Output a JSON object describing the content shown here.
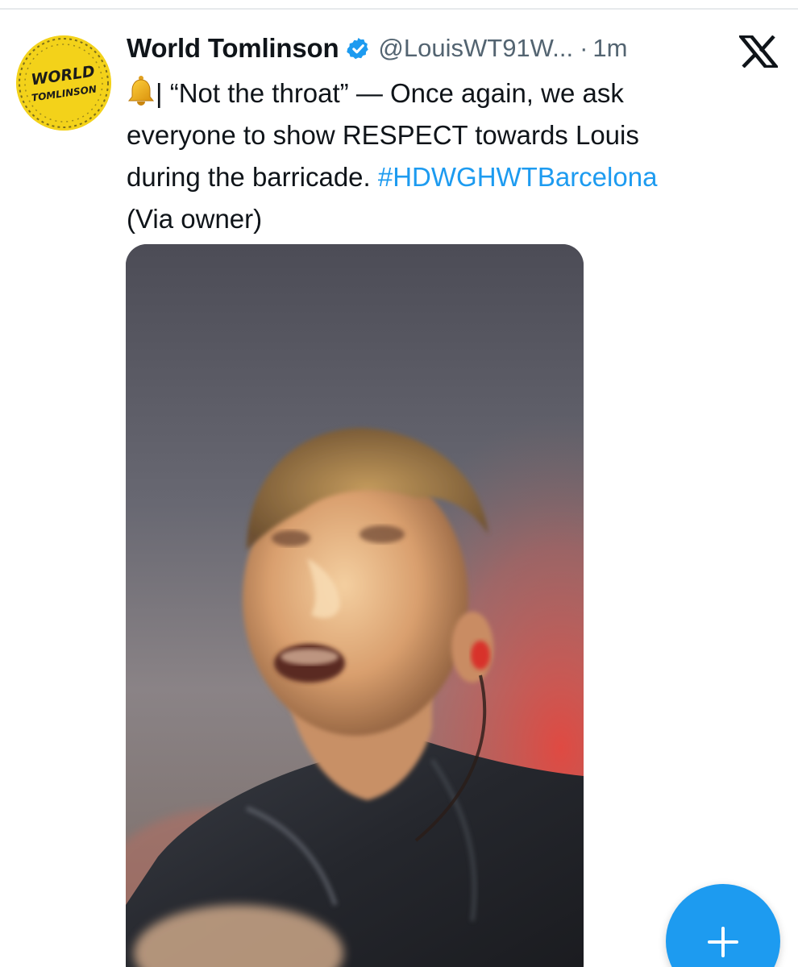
{
  "tweet": {
    "author": {
      "display_name": "World Tomlinson",
      "handle": "@LouisWT91W...",
      "verified": true,
      "avatar_text": [
        "WORLD",
        "TOMLINSON"
      ]
    },
    "separator": "·",
    "timestamp": "1m",
    "text": {
      "line1_rest": "| “Not the throat” — Once again, we ask",
      "line2": "everyone to show RESPECT towards Louis",
      "line3_text": "during the barricade. ",
      "hashtag": "#HDWGHWTBarcelona",
      "line4": "(Via owner)"
    },
    "icons": {
      "bell": "bell-emoji-icon",
      "verified": "verified-badge-icon",
      "platform": "x-logo-icon"
    },
    "media": {
      "type": "video-still"
    }
  },
  "compose_button": {
    "icon": "plus-icon"
  },
  "colors": {
    "text_primary": "#0f1419",
    "text_secondary": "#536471",
    "accent": "#1d9bf0",
    "avatar_bg": "#f3d21a"
  }
}
